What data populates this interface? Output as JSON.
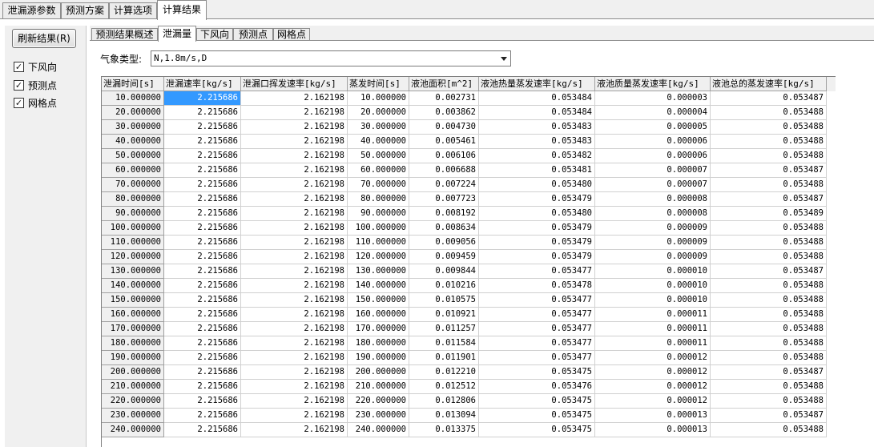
{
  "top_tabs": [
    "泄漏源参数",
    "预测方案",
    "计算选项",
    "计算结果"
  ],
  "left_panel": {
    "refresh_button": "刷新结果(R)",
    "checkboxes": [
      {
        "label": "下风向",
        "checked": true
      },
      {
        "label": "预测点",
        "checked": true
      },
      {
        "label": "网格点",
        "checked": true
      }
    ]
  },
  "sub_tabs": [
    "预测结果概述",
    "泄漏量",
    "下风向",
    "预测点",
    "网格点"
  ],
  "weather": {
    "label": "气象类型:",
    "value": "N,1.8m/s,D"
  },
  "table": {
    "headers": [
      "泄漏时间[s]",
      "泄漏速率[kg/s]",
      "泄漏口挥发速率[kg/s]",
      "蒸发时间[s]",
      "液池面积[m^2]",
      "液池热量蒸发速率[kg/s]",
      "液池质量蒸发速率[kg/s]",
      "液池总的蒸发速率[kg/s]"
    ],
    "rows": [
      [
        "10.000000",
        "2.215686",
        "2.162198",
        "10.000000",
        "0.002731",
        "0.053484",
        "0.000003",
        "0.053487"
      ],
      [
        "20.000000",
        "2.215686",
        "2.162198",
        "20.000000",
        "0.003862",
        "0.053484",
        "0.000004",
        "0.053488"
      ],
      [
        "30.000000",
        "2.215686",
        "2.162198",
        "30.000000",
        "0.004730",
        "0.053483",
        "0.000005",
        "0.053488"
      ],
      [
        "40.000000",
        "2.215686",
        "2.162198",
        "40.000000",
        "0.005461",
        "0.053483",
        "0.000006",
        "0.053488"
      ],
      [
        "50.000000",
        "2.215686",
        "2.162198",
        "50.000000",
        "0.006106",
        "0.053482",
        "0.000006",
        "0.053488"
      ],
      [
        "60.000000",
        "2.215686",
        "2.162198",
        "60.000000",
        "0.006688",
        "0.053481",
        "0.000007",
        "0.053487"
      ],
      [
        "70.000000",
        "2.215686",
        "2.162198",
        "70.000000",
        "0.007224",
        "0.053480",
        "0.000007",
        "0.053488"
      ],
      [
        "80.000000",
        "2.215686",
        "2.162198",
        "80.000000",
        "0.007723",
        "0.053479",
        "0.000008",
        "0.053487"
      ],
      [
        "90.000000",
        "2.215686",
        "2.162198",
        "90.000000",
        "0.008192",
        "0.053480",
        "0.000008",
        "0.053489"
      ],
      [
        "100.000000",
        "2.215686",
        "2.162198",
        "100.000000",
        "0.008634",
        "0.053479",
        "0.000009",
        "0.053488"
      ],
      [
        "110.000000",
        "2.215686",
        "2.162198",
        "110.000000",
        "0.009056",
        "0.053479",
        "0.000009",
        "0.053488"
      ],
      [
        "120.000000",
        "2.215686",
        "2.162198",
        "120.000000",
        "0.009459",
        "0.053479",
        "0.000009",
        "0.053488"
      ],
      [
        "130.000000",
        "2.215686",
        "2.162198",
        "130.000000",
        "0.009844",
        "0.053477",
        "0.000010",
        "0.053487"
      ],
      [
        "140.000000",
        "2.215686",
        "2.162198",
        "140.000000",
        "0.010216",
        "0.053478",
        "0.000010",
        "0.053488"
      ],
      [
        "150.000000",
        "2.215686",
        "2.162198",
        "150.000000",
        "0.010575",
        "0.053477",
        "0.000010",
        "0.053488"
      ],
      [
        "160.000000",
        "2.215686",
        "2.162198",
        "160.000000",
        "0.010921",
        "0.053477",
        "0.000011",
        "0.053488"
      ],
      [
        "170.000000",
        "2.215686",
        "2.162198",
        "170.000000",
        "0.011257",
        "0.053477",
        "0.000011",
        "0.053488"
      ],
      [
        "180.000000",
        "2.215686",
        "2.162198",
        "180.000000",
        "0.011584",
        "0.053477",
        "0.000011",
        "0.053488"
      ],
      [
        "190.000000",
        "2.215686",
        "2.162198",
        "190.000000",
        "0.011901",
        "0.053477",
        "0.000012",
        "0.053488"
      ],
      [
        "200.000000",
        "2.215686",
        "2.162198",
        "200.000000",
        "0.012210",
        "0.053475",
        "0.000012",
        "0.053487"
      ],
      [
        "210.000000",
        "2.215686",
        "2.162198",
        "210.000000",
        "0.012512",
        "0.053476",
        "0.000012",
        "0.053488"
      ],
      [
        "220.000000",
        "2.215686",
        "2.162198",
        "220.000000",
        "0.012806",
        "0.053475",
        "0.000012",
        "0.053488"
      ],
      [
        "230.000000",
        "2.215686",
        "2.162198",
        "230.000000",
        "0.013094",
        "0.053475",
        "0.000013",
        "0.053487"
      ],
      [
        "240.000000",
        "2.215686",
        "2.162198",
        "240.000000",
        "0.013375",
        "0.053475",
        "0.000013",
        "0.053488"
      ]
    ]
  }
}
